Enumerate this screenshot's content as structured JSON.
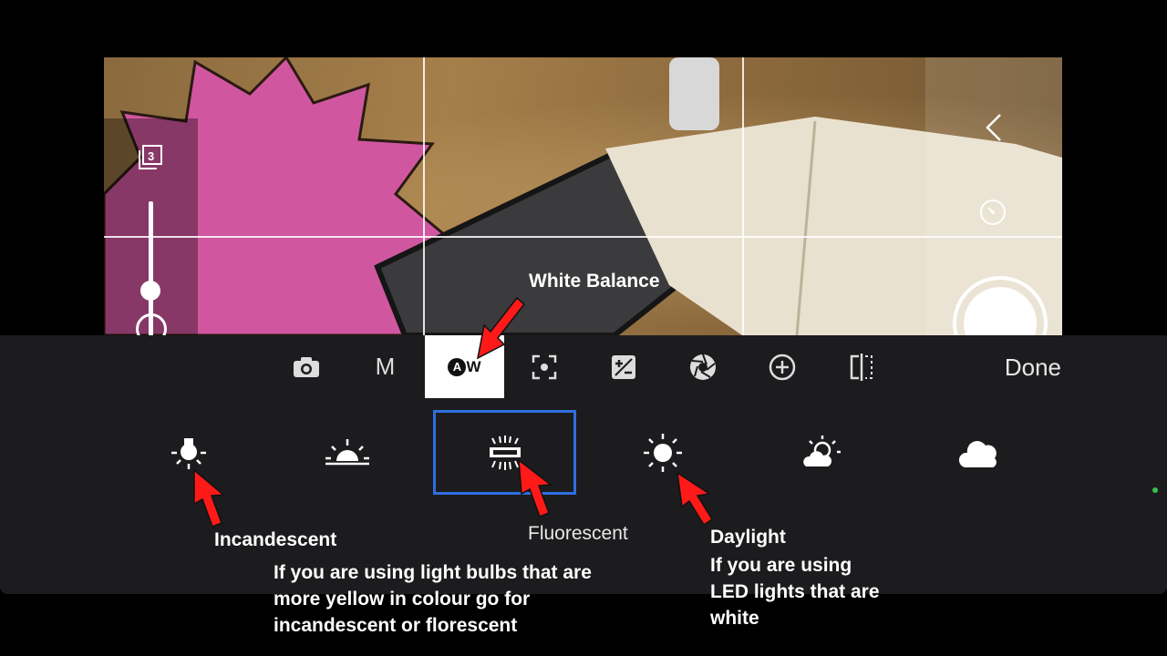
{
  "toolbar": {
    "items": [
      {
        "name": "camera-mode-icon",
        "icon": "camera",
        "label": ""
      },
      {
        "name": "manual-mode-button",
        "icon": "",
        "label": "M"
      },
      {
        "name": "white-balance-button",
        "icon": "auto-white-balance",
        "label": "A",
        "label2": "W"
      },
      {
        "name": "focus-icon",
        "icon": "focus-frame",
        "label": ""
      },
      {
        "name": "exposure-icon",
        "icon": "exposure",
        "label": ""
      },
      {
        "name": "aperture-icon",
        "icon": "aperture",
        "label": ""
      },
      {
        "name": "zoom-add-icon",
        "icon": "plus-circle",
        "label": ""
      },
      {
        "name": "compare-icon",
        "icon": "split-compare",
        "label": ""
      }
    ],
    "done_label": "Done"
  },
  "white_balance_options": [
    {
      "name": "incandescent",
      "icon": "bulb-icon",
      "selected": false
    },
    {
      "name": "sunset",
      "icon": "sunrise-icon",
      "selected": false
    },
    {
      "name": "fluorescent",
      "icon": "fluorescent-icon",
      "selected": true
    },
    {
      "name": "daylight",
      "icon": "sun-icon",
      "selected": false
    },
    {
      "name": "partly-cloudy",
      "icon": "sun-cloud-icon",
      "selected": false
    },
    {
      "name": "cloudy",
      "icon": "cloud-icon",
      "selected": false
    }
  ],
  "annotations": {
    "white_balance": "White Balance",
    "incandescent": "Incandescent",
    "fluorescent": "Fluorescent",
    "daylight": "Daylight",
    "bulb_tip": [
      "If you are using light bulbs that are",
      "more yellow in colour go for",
      "incandescent or florescent"
    ],
    "led_tip": [
      "If you are using",
      "LED lights that are",
      "white"
    ]
  },
  "viewfinder": {
    "stack_count": "3"
  },
  "colors": {
    "selection_border": "#2f6fe0",
    "arrow": "#ff1a1a",
    "panel_bg": "#1c1c1e"
  }
}
